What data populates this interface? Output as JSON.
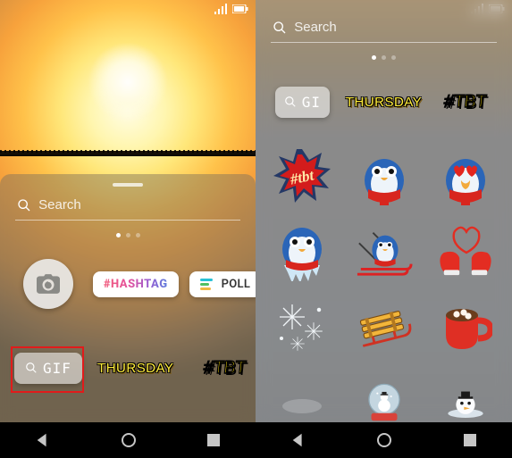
{
  "left": {
    "search_placeholder": "Search",
    "dots": {
      "count": 3,
      "active": 0
    },
    "row1": {
      "hashtag_label": "#HASHTAG",
      "poll_label": "POLL"
    },
    "row2": {
      "gif_label": "GIF",
      "thursday_label": "THURSDAY",
      "tbt_label": "#TBT"
    }
  },
  "navbar": {
    "back": "◀",
    "home": "○",
    "recent": "■"
  },
  "right": {
    "search_placeholder": "Search",
    "dots": {
      "count": 3,
      "active": 0
    },
    "row1": {
      "gif_label": "GI",
      "thursday_label": "THURSDAY",
      "tbt_label": "#TBT"
    },
    "stickers": [
      {
        "name": "tbt-burst-sticker"
      },
      {
        "name": "penguin-sticker"
      },
      {
        "name": "penguin-hearteyes-sticker"
      },
      {
        "name": "penguin-icicles-sticker"
      },
      {
        "name": "penguin-ski-sticker"
      },
      {
        "name": "mittens-heart-sticker"
      },
      {
        "name": "snowflakes-sticker"
      },
      {
        "name": "sled-sticker"
      },
      {
        "name": "hot-cocoa-sticker"
      },
      {
        "name": "placeholder-sticker"
      },
      {
        "name": "snowglobe-sticker"
      },
      {
        "name": "snowman-emerge-sticker"
      }
    ]
  },
  "colors": {
    "highlight": "#e11b1b",
    "thursday_fill": "#ffec3a",
    "tbt_fill": "#ffe20a"
  }
}
